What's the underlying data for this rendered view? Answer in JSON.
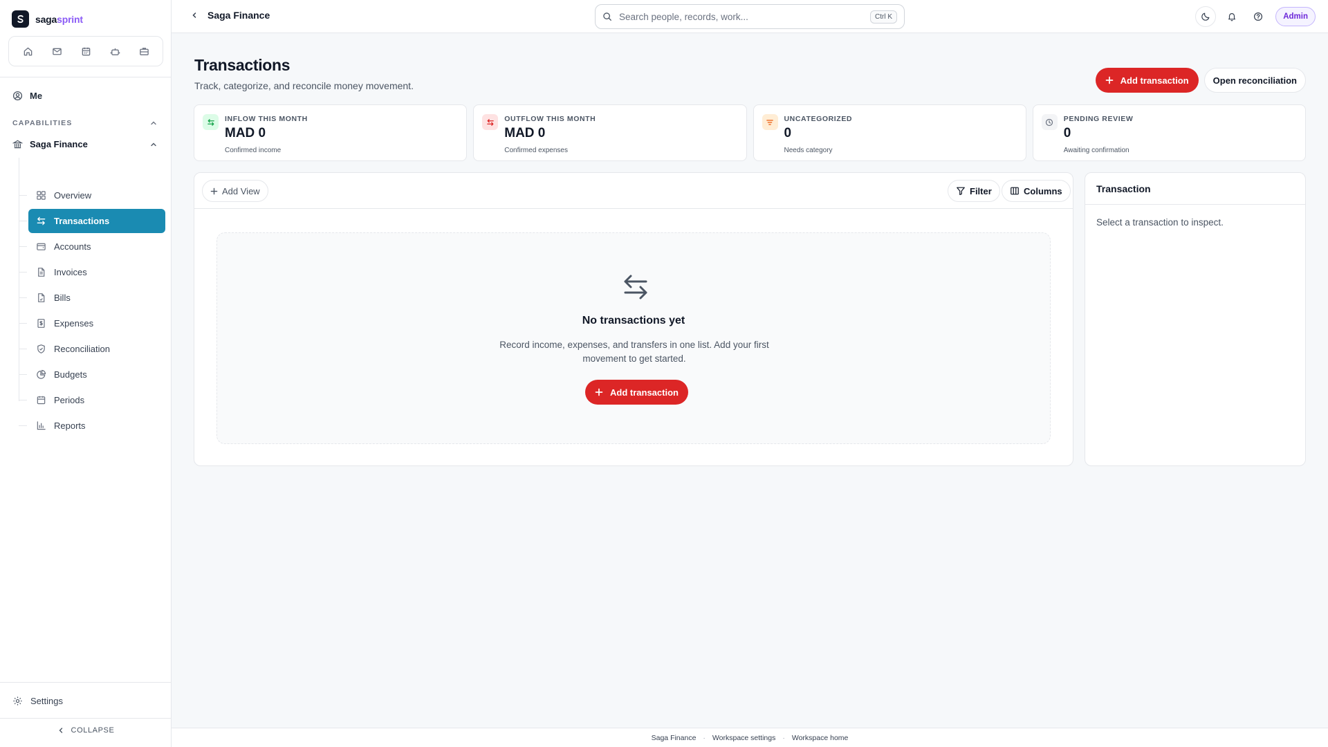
{
  "brand": {
    "name_main": "saga",
    "name_accent": "sprint"
  },
  "quick_bar": [
    "home-icon",
    "mail-icon",
    "calendar-icon",
    "robot-icon",
    "briefcase-icon"
  ],
  "sidebar": {
    "me_label": "Me",
    "capabilities_label": "CAPABILITIES",
    "module_label": "Saga Finance",
    "items": [
      {
        "label": "Overview",
        "icon": "grid-icon",
        "active": false
      },
      {
        "label": "Transactions",
        "icon": "arrows-swap-icon",
        "active": true
      },
      {
        "label": "Accounts",
        "icon": "wallet-icon",
        "active": false
      },
      {
        "label": "Invoices",
        "icon": "document-icon",
        "active": false
      },
      {
        "label": "Bills",
        "icon": "bill-icon",
        "active": false
      },
      {
        "label": "Expenses",
        "icon": "receipt-icon",
        "active": false
      },
      {
        "label": "Reconciliation",
        "icon": "shield-check-icon",
        "active": false
      },
      {
        "label": "Budgets",
        "icon": "pie-chart-icon",
        "active": false
      },
      {
        "label": "Periods",
        "icon": "calendar-icon",
        "active": false
      },
      {
        "label": "Reports",
        "icon": "bar-chart-icon",
        "active": false
      }
    ],
    "settings_label": "Settings",
    "collapse_label": "COLLAPSE"
  },
  "topbar": {
    "back_title": "Saga Finance",
    "search_placeholder": "Search people, records, work...",
    "search_shortcut": "Ctrl K",
    "admin_label": "Admin"
  },
  "page": {
    "title": "Transactions",
    "subtitle": "Track, categorize, and reconcile money movement.",
    "add_transaction_label": "Add transaction",
    "open_reconciliation_label": "Open reconciliation"
  },
  "stats": [
    {
      "label": "INFLOW THIS MONTH",
      "value": "MAD 0",
      "note": "Confirmed income",
      "icon": "arrows-swap-icon",
      "color": "#16a34a",
      "bg": "#dcfce7"
    },
    {
      "label": "OUTFLOW THIS MONTH",
      "value": "MAD 0",
      "note": "Confirmed expenses",
      "icon": "arrows-swap-icon",
      "color": "#dc2626",
      "bg": "#fee2e2"
    },
    {
      "label": "UNCATEGORIZED",
      "value": "0",
      "note": "Needs category",
      "icon": "filter-lines-icon",
      "color": "#ea580c",
      "bg": "#ffedd5"
    },
    {
      "label": "PENDING REVIEW",
      "value": "0",
      "note": "Awaiting confirmation",
      "icon": "clock-icon",
      "color": "#6b7280",
      "bg": "#f3f4f6"
    }
  ],
  "list": {
    "add_view_label": "Add View",
    "filter_label": "Filter",
    "columns_label": "Columns",
    "empty_title": "No transactions yet",
    "empty_text": "Record income, expenses, and transfers in one list. Add your first movement to get started.",
    "empty_cta_label": "Add transaction"
  },
  "detail": {
    "title": "Transaction",
    "placeholder": "Select a transaction to inspect."
  },
  "footer": {
    "links": [
      "Saga Finance",
      "Workspace settings",
      "Workspace home"
    ],
    "separator": "·"
  },
  "colors": {
    "accent": "#1a8bb2",
    "primary": "#dc2626",
    "brand_accent": "#8b5cf6"
  }
}
